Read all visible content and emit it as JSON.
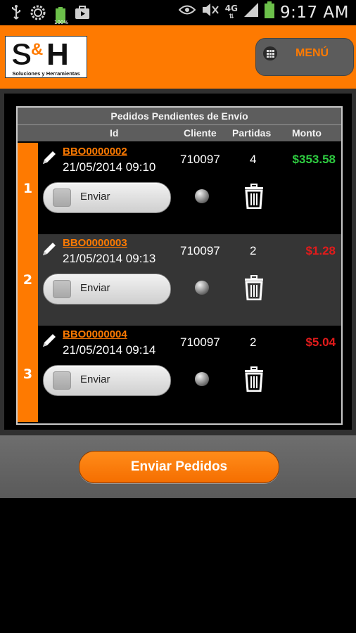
{
  "status_bar": {
    "time": "9:17 AM",
    "battery_level": "100%",
    "network": "4G",
    "icons": [
      "usb-icon",
      "settings-icon",
      "battery-icon",
      "briefcase-icon",
      "eye-icon",
      "mute-icon",
      "network-4g-icon",
      "signal-icon",
      "battery-full-icon"
    ]
  },
  "header": {
    "logo_text": "S&H",
    "logo_tagline": "Soluciones y Herramientas",
    "menu_label": "MENÚ",
    "accent_color": "#fe7a01"
  },
  "table": {
    "title": "Pedidos Pendientes de Envío",
    "columns": {
      "id": "Id",
      "cliente": "Cliente",
      "partidas": "Partidas",
      "monto": "Monto"
    },
    "rows": [
      {
        "num": "1",
        "id": "BBO0000002",
        "date": "21/05/2014 09:10",
        "cliente": "710097",
        "partidas": "4",
        "monto": "$353.58",
        "monto_color": "#2ecc40",
        "send_label": "Enviar",
        "send_checked": false
      },
      {
        "num": "2",
        "id": "BBO0000003",
        "date": "21/05/2014 09:13",
        "cliente": "710097",
        "partidas": "2",
        "monto": "$1.28",
        "monto_color": "#e21b1b",
        "send_label": "Enviar",
        "send_checked": false
      },
      {
        "num": "3",
        "id": "BBO0000004",
        "date": "21/05/2014 09:14",
        "cliente": "710097",
        "partidas": "2",
        "monto": "$5.04",
        "monto_color": "#e21b1b",
        "send_label": "Enviar",
        "send_checked": false
      }
    ]
  },
  "footer": {
    "send_all_label": "Enviar Pedidos"
  }
}
